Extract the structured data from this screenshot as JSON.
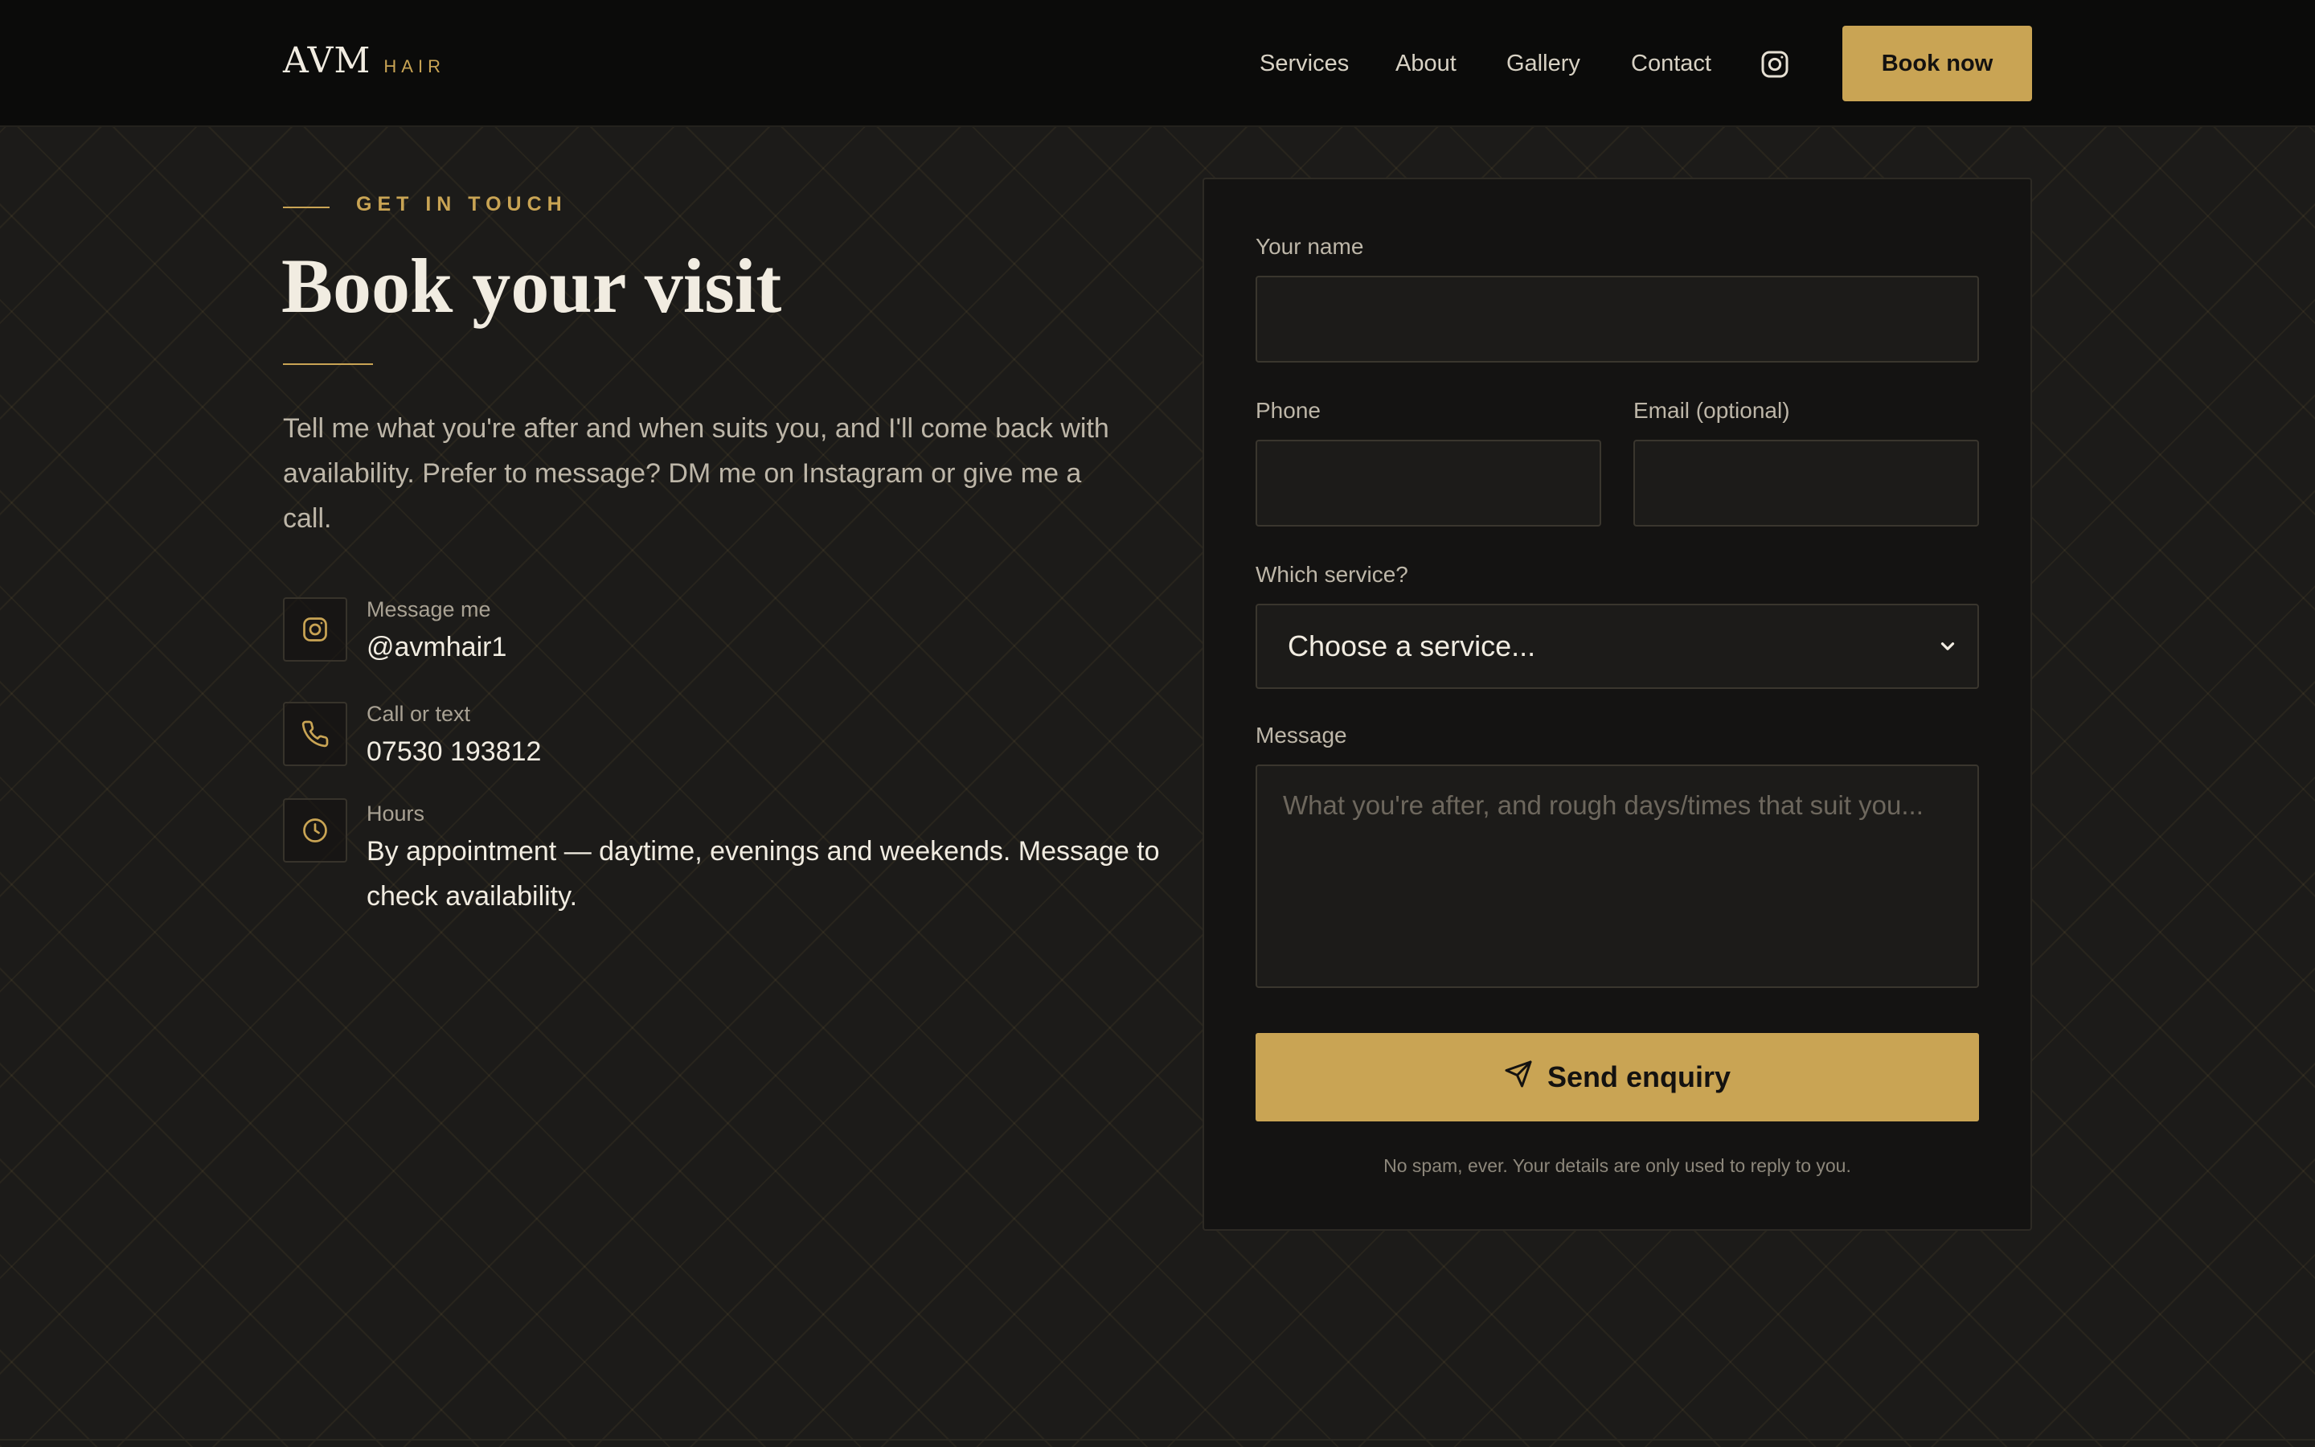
{
  "colors": {
    "accent": "#c9a454",
    "background": "#1c1b19",
    "header": "#0b0b0a",
    "text": "#f1ece1"
  },
  "brand": {
    "main": "AVM",
    "sub": "HAIR"
  },
  "nav": {
    "items": [
      "Services",
      "About",
      "Gallery",
      "Contact"
    ],
    "instagram_icon": "instagram-icon",
    "book_now": "Book now"
  },
  "hero": {
    "eyebrow": "GET IN TOUCH",
    "title": "Book your visit",
    "intro": "Tell me what you're after and when suits you, and I'll come back with availability. Prefer to message? DM me on Instagram or give me a call."
  },
  "contact": {
    "instagram": {
      "icon": "instagram-icon",
      "label": "Message me",
      "value": "@avmhair1"
    },
    "phone": {
      "icon": "phone-icon",
      "label": "Call or text",
      "value": "07530 193812"
    },
    "hours": {
      "icon": "clock-icon",
      "label": "Hours",
      "value": "By appointment — daytime, evenings and weekends. Message to check availability."
    }
  },
  "form": {
    "name_label": "Your name",
    "name_value": "",
    "phone_label": "Phone",
    "phone_value": "",
    "email_label": "Email (optional)",
    "email_value": "",
    "service_label": "Which service?",
    "service_selected": "Choose a service...",
    "message_label": "Message",
    "message_placeholder": "What you're after, and rough days/times that suit you...",
    "submit_label": "Send enquiry",
    "submit_icon": "send-icon",
    "disclaimer": "No spam, ever. Your details are only used to reply to you."
  }
}
